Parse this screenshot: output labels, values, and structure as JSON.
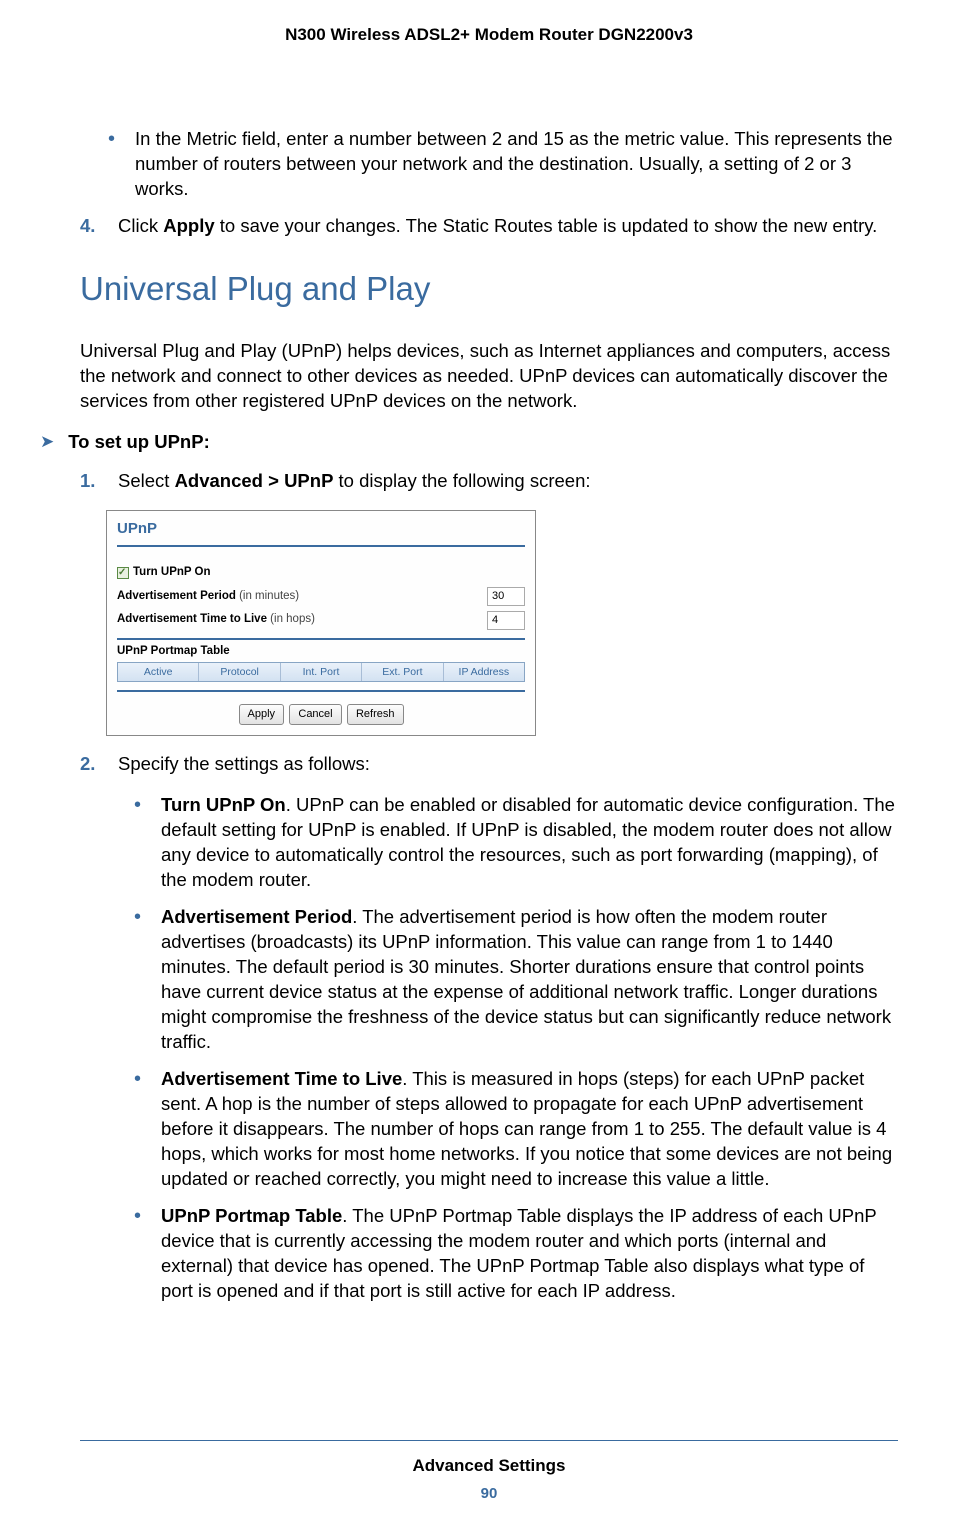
{
  "header": "N300 Wireless ADSL2+ Modem Router DGN2200v3",
  "b1": "In the Metric field, enter a number between 2 and 15 as the metric value. This represents the number of routers between your network and the destination. Usually, a setting of 2 or 3 works.",
  "step4_num": "4.",
  "step4_pre": "Click ",
  "step4_bold": "Apply",
  "step4_post": " to save your changes. The Static Routes table is updated to show the new entry.",
  "h1": "Universal Plug and Play",
  "intro": "Universal Plug and Play (UPnP) helps devices, such as Internet appliances and computers, access the network and connect to other devices as needed. UPnP devices can automatically discover the services from other registered UPnP devices on the network.",
  "proc": "To set up UPnP:",
  "s1_num": "1.",
  "s1_pre": "Select ",
  "s1_bold": "Advanced > UPnP",
  "s1_post": " to display the following screen:",
  "sc": {
    "title": "UPnP",
    "cb": "Turn UPnP On",
    "f1_label": "Advertisement Period",
    "f1_hint": " (in minutes)",
    "f1_val": "30",
    "f2_label": "Advertisement Time to Live",
    "f2_hint": " (in hops)",
    "f2_val": "4",
    "table_title": "UPnP Portmap Table",
    "th": [
      "Active",
      "Protocol",
      "Int. Port",
      "Ext. Port",
      "IP Address"
    ],
    "btn": [
      "Apply",
      "Cancel",
      "Refresh"
    ]
  },
  "s2_num": "2.",
  "s2_text": "Specify the settings as follows:",
  "sub": [
    {
      "lead": "Turn UPnP On",
      "text": ". UPnP can be enabled or disabled for automatic device configuration. The default setting for UPnP is enabled. If UPnP is disabled, the modem router does not allow any device to automatically control the resources, such as port forwarding (mapping), of the modem router."
    },
    {
      "lead": "Advertisement Period",
      "text": ". The advertisement period is how often the modem router advertises (broadcasts) its UPnP information. This value can range from 1 to 1440 minutes. The default period is 30 minutes. Shorter durations ensure that control points have current device status at the expense of additional network traffic. Longer durations might compromise the freshness of the device status but can significantly reduce network traffic."
    },
    {
      "lead": "Advertisement Time to Live",
      "text": ". This is measured in hops (steps) for each UPnP packet sent. A hop is the number of steps allowed to propagate for each UPnP advertisement before it disappears. The number of hops can range from 1 to 255. The default value is 4 hops, which works for most home networks. If you notice that some devices are not being updated or reached correctly, you might need to increase this value a little."
    },
    {
      "lead": "UPnP Portmap Table",
      "text": ". The UPnP Portmap Table displays the IP address of each UPnP device that is currently accessing the modem router and which ports (internal and external) that device has opened. The UPnP Portmap Table also displays what type of port is opened and if that port is still active for each IP address."
    }
  ],
  "footer_section": "Advanced Settings",
  "footer_page": "90"
}
